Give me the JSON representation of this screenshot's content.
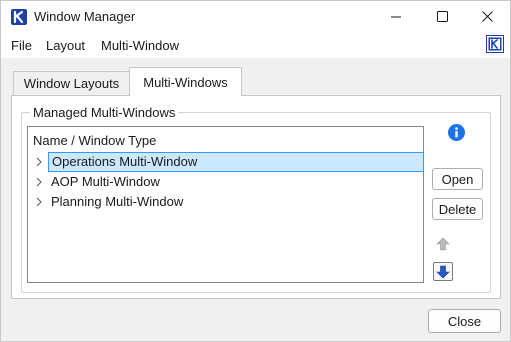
{
  "window": {
    "title": "Window Manager",
    "controls": {
      "minimize": "minimize-icon",
      "maximize": "maximize-icon",
      "close": "close-icon"
    }
  },
  "menu": {
    "items": [
      "File",
      "Layout",
      "Multi-Window"
    ],
    "icon": "window-manager-icon"
  },
  "tabs": [
    {
      "label": "Window Layouts",
      "active": false
    },
    {
      "label": "Multi-Windows",
      "active": true
    }
  ],
  "group": {
    "legend": "Managed Multi-Windows",
    "tree": {
      "header": "Name / Window Type",
      "rows": [
        {
          "label": "Operations Multi-Window",
          "selected": true,
          "expanded": false
        },
        {
          "label": "AOP Multi-Window",
          "selected": false,
          "expanded": false
        },
        {
          "label": "Planning Multi-Window",
          "selected": false,
          "expanded": false
        }
      ]
    }
  },
  "side_buttons": {
    "info": "info-icon",
    "open": "Open",
    "delete": "Delete",
    "move_up": "arrow-up-icon",
    "move_down": "arrow-down-icon"
  },
  "footer": {
    "close": "Close"
  },
  "colors": {
    "selection_fill": "#cce8ff",
    "selection_border": "#3399ff",
    "info_blue": "#1a73e8",
    "app_icon_blue": "#1f3fa8"
  }
}
